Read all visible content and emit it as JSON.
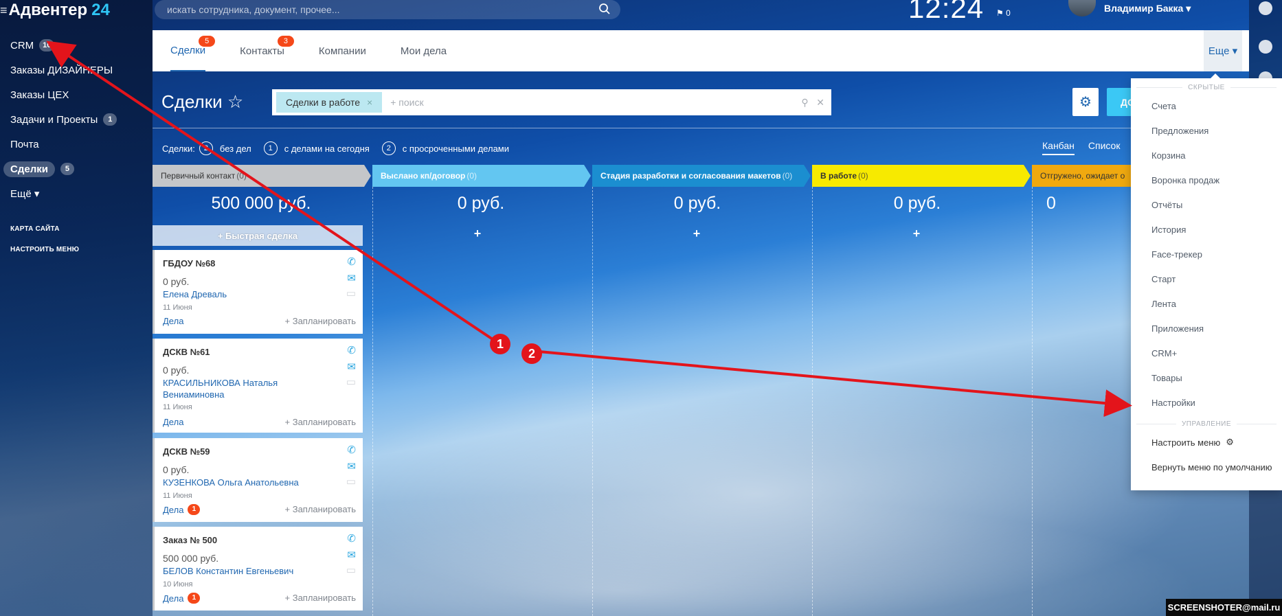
{
  "logo": {
    "burger": "≡",
    "name": "Адвентер",
    "number": "24"
  },
  "sidebar": {
    "items": [
      {
        "label": "CRM",
        "count": "10"
      },
      {
        "label": "Заказы ДИЗАЙНЕРЫ",
        "count": ""
      },
      {
        "label": "Заказы ЦЕХ",
        "count": ""
      },
      {
        "label": "Задачи и Проекты",
        "count": "1"
      },
      {
        "label": "Почта",
        "count": ""
      },
      {
        "label": "Сделки",
        "count": "5"
      },
      {
        "label": "Ещё ▾",
        "count": ""
      }
    ],
    "sitemap": "КАРТА САЙТА",
    "configure": "НАСТРОИТЬ МЕНЮ"
  },
  "topbar": {
    "search_placeholder": "искать сотрудника, документ, прочее...",
    "clock": "12:24",
    "flag_count": "0",
    "user_name": "Владимир Бакка ▾"
  },
  "tabs": [
    {
      "label": "Сделки",
      "badge": "5"
    },
    {
      "label": "Контакты",
      "badge": "3"
    },
    {
      "label": "Компании",
      "badge": ""
    },
    {
      "label": "Мои дела",
      "badge": ""
    }
  ],
  "more_label": "Еще ▾",
  "page": {
    "title": "Сделки ☆",
    "filter_chip": "Сделки в работе",
    "filter_placeholder": "+ поиск",
    "add_label": "ДО"
  },
  "counters": {
    "label": "Сделки:",
    "c1": "2",
    "t1": "без дел",
    "c2": "1",
    "t2": "с делами на сегодня",
    "c3": "2",
    "t3": "с просроченными делами"
  },
  "view": {
    "kanban": "Канбан",
    "list": "Список"
  },
  "columns": [
    {
      "name": "Первичный контакт",
      "n": "(0)",
      "sum": "500 000 руб.",
      "color": "#c4c6c9"
    },
    {
      "name": "Выслано кп/договор",
      "n": "(0)",
      "sum": "0 руб.",
      "color": "#63c6f1"
    },
    {
      "name": "Стадия разработки и согласования макетов",
      "n": "(0)",
      "sum": "0 руб.",
      "color": "#1b8ed0"
    },
    {
      "name": "В работе",
      "n": "(0)",
      "sum": "0 руб.",
      "color": "#f7ea00"
    },
    {
      "name": "Отгружено, ожидает о",
      "n": "",
      "sum": "0",
      "color": "#f0a90f"
    }
  ],
  "quick_deal": "+ Быстрая сделка",
  "plus": "+",
  "cards": [
    {
      "title": "ГБДОУ №68",
      "amount": "0 руб.",
      "person": "Елена Древаль",
      "date": "11 Июня",
      "deals": "Дела",
      "deals_count": "",
      "plan": "+ Запланировать"
    },
    {
      "title": "ДСКВ №61",
      "amount": "0 руб.",
      "person": "КРАСИЛЬНИКОВА Наталья Вениаминовна",
      "date": "11 Июня",
      "deals": "Дела",
      "deals_count": "",
      "plan": "+ Запланировать"
    },
    {
      "title": "ДСКВ №59",
      "amount": "0 руб.",
      "person": "КУЗЕНКОВА Ольга Анатольевна",
      "date": "11 Июня",
      "deals": "Дела",
      "deals_count": "1",
      "plan": "+ Запланировать"
    },
    {
      "title": "Заказ № 500",
      "amount": "500 000 руб.",
      "person": "БЕЛОВ Константин Евгеньевич",
      "date": "10 Июня",
      "deals": "Дела",
      "deals_count": "1",
      "plan": "+ Запланировать"
    }
  ],
  "menu": {
    "hidden_title": "СКРЫТЫЕ",
    "hidden": [
      "Счета",
      "Предложения",
      "Корзина",
      "Воронка продаж",
      "Отчёты",
      "История",
      "Face-трекер",
      "Старт",
      "Лента",
      "Приложения",
      "CRM+",
      "Товары",
      "Настройки"
    ],
    "manage_title": "УПРАВЛЕНИЕ",
    "configure": "Настроить меню",
    "reset": "Вернуть меню по умолчанию"
  },
  "markers": [
    "1",
    "2"
  ],
  "watermark": "SCREENSHOTER@mail.ru",
  "icons": {
    "phone": "phone-icon",
    "mail": "mail-icon",
    "chat": "chat-icon",
    "gear": "gear-icon",
    "search": "search-icon"
  },
  "accent_color": "#2067b0",
  "arrow_color": "#e3141b"
}
